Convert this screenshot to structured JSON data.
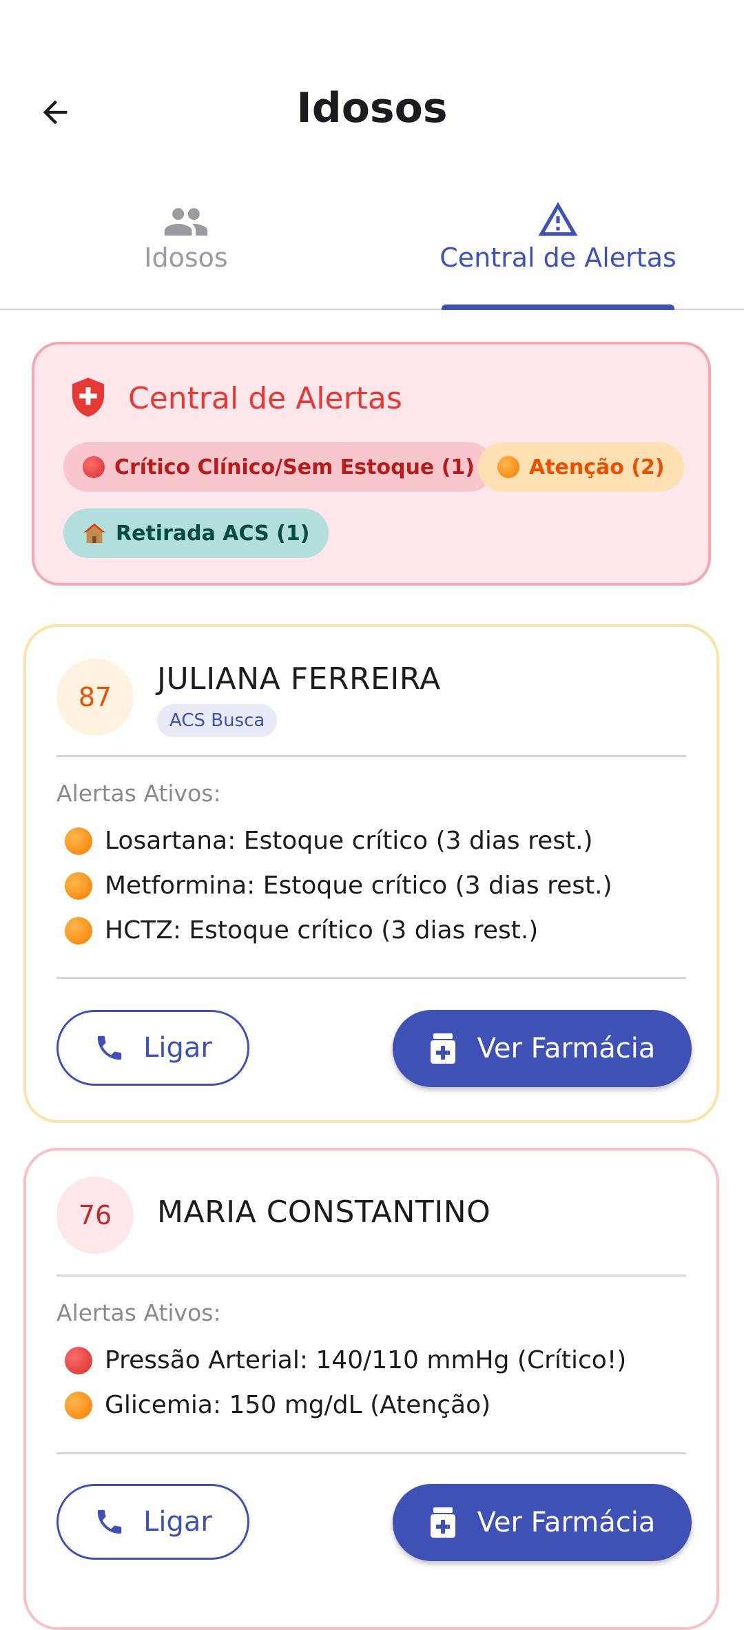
{
  "appbar": {
    "title": "Idosos",
    "back_icon": "arrow-back-icon"
  },
  "tabs": [
    {
      "label": "Idosos",
      "icon": "people-icon",
      "active": false
    },
    {
      "label": "Central de Alertas",
      "icon": "warning-triangle-icon",
      "active": true
    }
  ],
  "alert_center": {
    "title": "Central de Alertas",
    "icon": "shield-plus-icon",
    "chips": {
      "critical": "Crítico Clínico/Sem Estoque (1)",
      "attention": "Atenção (2)",
      "acs": "Retirada ACS (1)"
    }
  },
  "cards": [
    {
      "age": "87",
      "name": "JULIANA FERREIRA",
      "tag": "ACS Busca",
      "alerts_label": "Alertas Ativos:",
      "alerts": [
        {
          "level": "attention",
          "text": "Losartana: Estoque crítico (3 dias rest.)"
        },
        {
          "level": "attention",
          "text": "Metformina: Estoque crítico (3 dias rest.)"
        },
        {
          "level": "attention",
          "text": "HCTZ: Estoque crítico (3 dias rest.)"
        }
      ],
      "call_label": "Ligar",
      "pharmacy_label": "Ver Farmácia"
    },
    {
      "age": "76",
      "name": "MARIA CONSTANTINO",
      "alerts_label": "Alertas Ativos:",
      "alerts": [
        {
          "level": "critical",
          "text": "Pressão Arterial: 140/110 mmHg (Crítico!)"
        },
        {
          "level": "attention",
          "text": "Glicemia: 150 mg/dL (Atenção)"
        }
      ],
      "call_label": "Ligar",
      "pharmacy_label": "Ver Farmácia"
    }
  ],
  "colors": {
    "primary": "#3f51b5",
    "critical": "#e53935",
    "attention": "#f57c00",
    "acs": "#004d40"
  }
}
